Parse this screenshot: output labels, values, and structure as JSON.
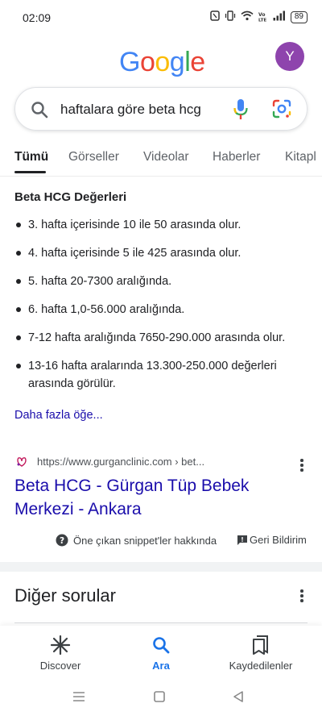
{
  "status_bar": {
    "time": "02:09",
    "battery": "89",
    "signal_label": "Vo LTE"
  },
  "header": {
    "logo_letters": [
      {
        "char": "G",
        "color": "#4285F4"
      },
      {
        "char": "o",
        "color": "#EA4335"
      },
      {
        "char": "o",
        "color": "#FBBC05"
      },
      {
        "char": "g",
        "color": "#4285F4"
      },
      {
        "char": "l",
        "color": "#34A853"
      },
      {
        "char": "e",
        "color": "#EA4335"
      }
    ],
    "avatar_letter": "Y",
    "avatar_color": "#8e44ad"
  },
  "search": {
    "query": "haftalara göre beta hcg",
    "icons": [
      "search-icon",
      "microphone-icon",
      "google-lens-icon"
    ]
  },
  "tabs": [
    {
      "label": "Tümü",
      "active": true
    },
    {
      "label": "Görseller",
      "active": false
    },
    {
      "label": "Videolar",
      "active": false
    },
    {
      "label": "Haberler",
      "active": false
    },
    {
      "label": "Kitapl",
      "active": false
    }
  ],
  "snippet": {
    "title": "Beta HCG Değerleri",
    "items": [
      "3. hafta içerisinde 10 ile 50 arasında olur.",
      "4. hafta içerisinde 5 ile 425 arasında olur.",
      "5. hafta 20-7300 aralığında.",
      "6. hafta 1,0-56.000 aralığında.",
      "7-12 hafta aralığında 7650-290.000 arasında olur.",
      "13-16 hafta aralarında 13.300-250.000 değerleri arasında görülür."
    ],
    "more_link": "Daha fazla öğe..."
  },
  "result": {
    "url": "https://www.gurganclinic.com › bet...",
    "title": "Beta HCG - Gürgan Tüp Bebek Merkezi - Ankara",
    "link_color": "#1a0dab"
  },
  "about_row": {
    "about_snippets": "Öne çıkan snippet'ler hakkında",
    "feedback": "Geri Bildirim"
  },
  "other_questions": {
    "title": "Diğer sorular"
  },
  "bottom_nav": {
    "items": [
      {
        "label": "Discover",
        "icon": "discover-asterisk-icon",
        "active": false
      },
      {
        "label": "Ara",
        "icon": "search-icon",
        "active": true
      },
      {
        "label": "Kaydedilenler",
        "icon": "bookmarks-icon",
        "active": false
      }
    ],
    "active_color": "#1a73e8"
  },
  "system_nav": {
    "buttons": [
      "menu-icon",
      "home-icon",
      "back-icon"
    ]
  }
}
